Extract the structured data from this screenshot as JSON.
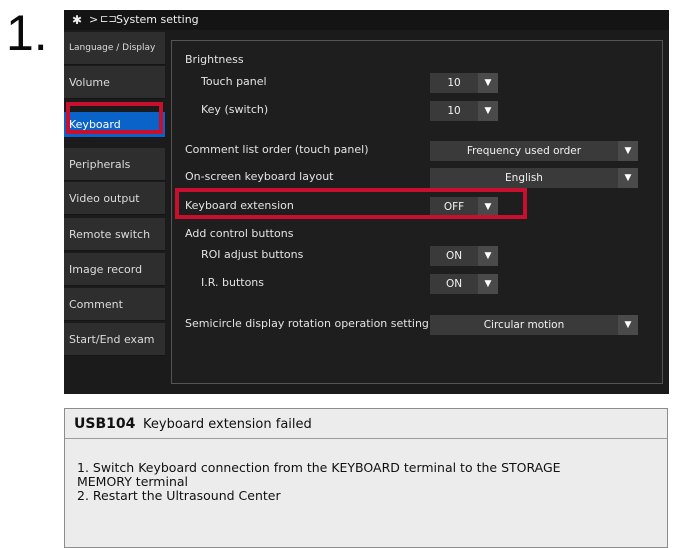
{
  "step_number": "1.",
  "titlebar": {
    "breadcrumb_separator": ">",
    "breadcrumb": "System setting"
  },
  "sidebar": {
    "items": [
      {
        "label": "Language / Display"
      },
      {
        "label": "Volume"
      },
      {
        "label": "Keyboard",
        "selected": true
      },
      {
        "label": "Peripherals"
      },
      {
        "label": "Video output"
      },
      {
        "label": "Remote switch"
      },
      {
        "label": "Image record"
      },
      {
        "label": "Comment"
      },
      {
        "label": "Start/End exam"
      }
    ]
  },
  "settings": {
    "brightness": {
      "label": "Brightness",
      "touch_panel": {
        "label": "Touch panel",
        "value": "10"
      },
      "key_switch": {
        "label": "Key (switch)",
        "value": "10"
      }
    },
    "comment_list_order": {
      "label": "Comment list order (touch panel)",
      "value": "Frequency used order"
    },
    "onscreen_keyboard_layout": {
      "label": "On-screen keyboard layout",
      "value": "English"
    },
    "keyboard_extension": {
      "label": "Keyboard extension",
      "value": "OFF"
    },
    "add_control_buttons": {
      "label": "Add control buttons",
      "roi_adjust": {
        "label": "ROI adjust buttons",
        "value": "ON"
      },
      "ir_buttons": {
        "label": "I.R. buttons",
        "value": "ON"
      }
    },
    "semicircle_rotation": {
      "label": "Semicircle display rotation operation setting",
      "value": "Circular motion"
    }
  },
  "message": {
    "code": "USB104",
    "title": "Keyboard extension failed",
    "line1": "1. Switch Keyboard connection from the KEYBOARD terminal to the STORAGE",
    "line2": "MEMORY terminal",
    "line3": "2. Restart the Ultrasound Center"
  },
  "icons": {
    "gear": "gear-icon",
    "system": "system-setting-icon",
    "dropdown": "chevron-down-icon"
  },
  "colors": {
    "selected_tab": "#0a63c9",
    "highlight_frame": "#c8102e",
    "screen_bg": "#1b1b1b"
  }
}
